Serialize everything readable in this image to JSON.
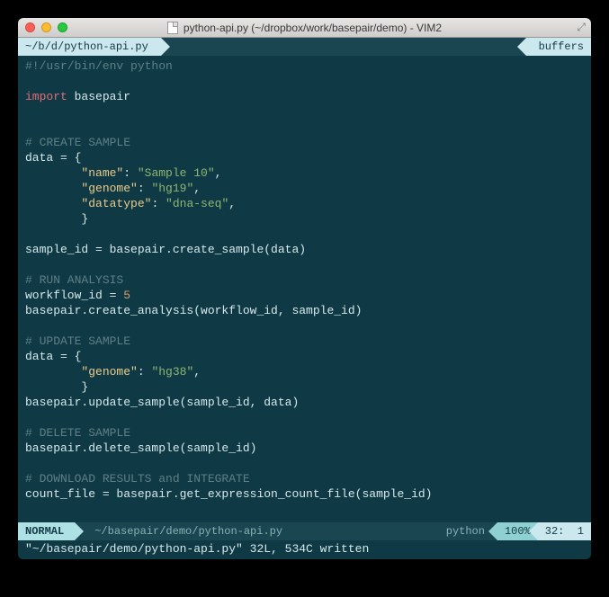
{
  "window": {
    "title": "python-api.py (~/dropbox/work/basepair/demo) - VIM2"
  },
  "tabbar": {
    "file_tab": "~/b/d/python-api.py",
    "buffers_label": "buffers"
  },
  "code": {
    "l1_shebang": "#!/usr/bin/env python",
    "l2_blank": "",
    "l3_import": "import",
    "l3_module": " basepair",
    "l4_blank": "",
    "l5_blank": "",
    "l6_comment": "# CREATE SAMPLE",
    "l7": "data = {",
    "l8_key": "\"name\"",
    "l8_sep": ": ",
    "l8_val": "\"Sample 10\"",
    "l8_end": ",",
    "l9_key": "\"genome\"",
    "l9_sep": ": ",
    "l9_val": "\"hg19\"",
    "l9_end": ",",
    "l10_key": "\"datatype\"",
    "l10_sep": ": ",
    "l10_val": "\"dna-seq\"",
    "l10_end": ",",
    "l11": "        }",
    "l12_blank": "",
    "l13": "sample_id = basepair.create_sample(data)",
    "l14_blank": "",
    "l15_comment": "# RUN ANALYSIS",
    "l16a": "workflow_id = ",
    "l16b": "5",
    "l17": "basepair.create_analysis(workflow_id, sample_id)",
    "l18_blank": "",
    "l19_comment": "# UPDATE SAMPLE",
    "l20": "data = {",
    "l21_key": "\"genome\"",
    "l21_sep": ": ",
    "l21_val": "\"hg38\"",
    "l21_end": ",",
    "l22": "        }",
    "l23": "basepair.update_sample(sample_id, data)",
    "l24_blank": "",
    "l25_comment": "# DELETE SAMPLE",
    "l26": "basepair.delete_sample(sample_id)",
    "l27_blank": "",
    "l28_comment": "# DOWNLOAD RESULTS and INTEGRATE",
    "l29": "count_file = basepair.get_expression_count_file(sample_id)",
    "l30_blank": "",
    "l31_blank": ""
  },
  "status": {
    "mode": "NORMAL",
    "filepath": "~/basepair/demo/python-api.py",
    "filetype": "python",
    "percent": "100%",
    "line": "32:",
    "col": "1"
  },
  "cmdline": "\"~/basepair/demo/python-api.py\" 32L, 534C written"
}
